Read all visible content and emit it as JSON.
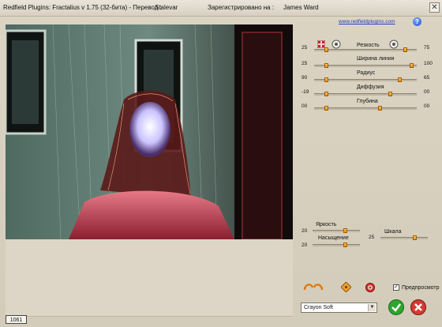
{
  "titlebar": {
    "app_title": "Redfield Plugins: Fractalius v 1.75 (32-бита)  - Перевод :",
    "translator": "Stalevar",
    "registered_label": "Зарегистрировано на :",
    "registered_name": "James Ward",
    "close_glyph": "✕"
  },
  "header": {
    "link_text": "www.redfieldplugins.com",
    "help_glyph": "?"
  },
  "sliders_top": [
    {
      "label": "Резкость",
      "left_value": "25",
      "right_value": "75",
      "level_left": 0.1,
      "level_right": 0.9
    },
    {
      "label": "Ширина линии",
      "left_value": "25",
      "right_value": "100",
      "level_left": 0.1,
      "level_right": 0.97
    },
    {
      "label": "Радиус",
      "left_value": "90",
      "right_value": "65",
      "level_left": 0.1,
      "level_right": 0.85
    },
    {
      "label": "Диффузия",
      "left_value": "-19",
      "right_value": "00",
      "level_left": 0.1,
      "level_right": 0.75
    },
    {
      "label": "Глубина",
      "left_value": "00",
      "right_value": "00",
      "level_left": 0.1,
      "level_right": 0.65
    }
  ],
  "sliders_bottom": {
    "brightness": {
      "label": "Яркость",
      "value": "20",
      "level": 0.7
    },
    "saturation": {
      "label": "Насыщение",
      "value": "20",
      "level": 0.7
    },
    "scale": {
      "label": "Шкала",
      "value": "25",
      "level": 0.75
    }
  },
  "preset": {
    "selected": "Crayon Soft",
    "arrow": "▼"
  },
  "preview_label": "Предпросмотр",
  "preview_checked": "✓",
  "status_value": "1061",
  "colors": {
    "ok": "#2fa52f",
    "cancel": "#d63b2f",
    "accent": "#e48a0c"
  }
}
